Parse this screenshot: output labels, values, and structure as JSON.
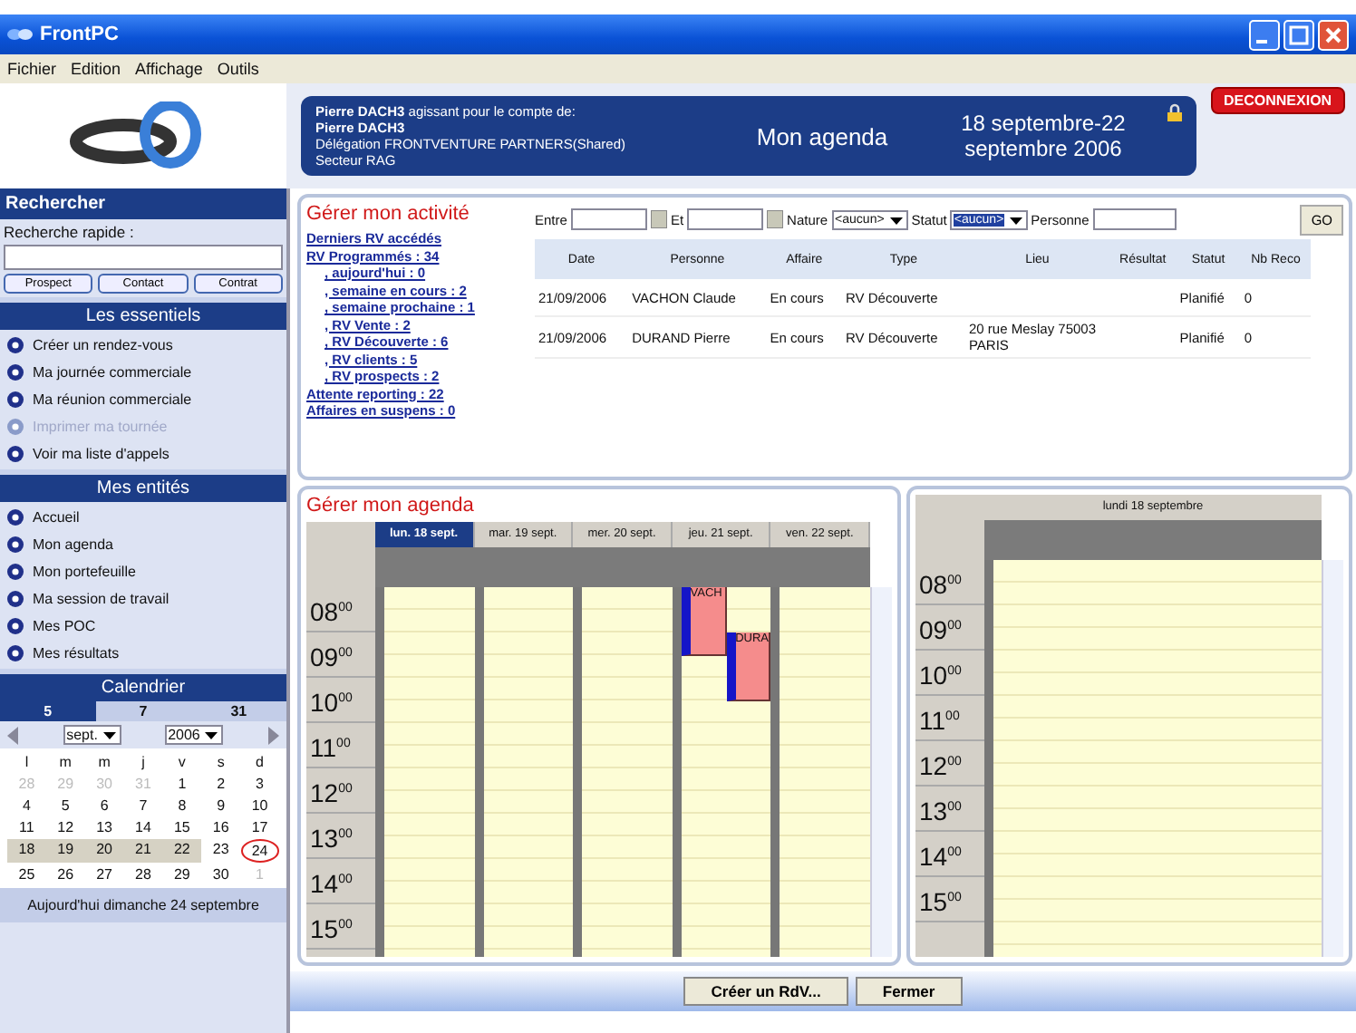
{
  "window": {
    "title": "FrontPC"
  },
  "menu": [
    "Fichier",
    "Edition",
    "Affichage",
    "Outils"
  ],
  "header": {
    "account_lines": [
      {
        "text": "**Pierre DACH3** agissant pour le compte de:",
        "bold": false
      },
      {
        "text": "Pierre DACH3",
        "bold": true
      },
      {
        "text": "Délégation FRONTVENTURE PARTNERS(Shared)",
        "bold": false
      },
      {
        "text": "Secteur RAG",
        "bold": false
      }
    ],
    "page_title": "Mon agenda",
    "date_range": "18 septembre-22 septembre 2006",
    "logout": "DECONNEXION"
  },
  "sidebar": {
    "search": {
      "title": "Rechercher",
      "label": "Recherche rapide :",
      "buttons": [
        "Prospect",
        "Contact",
        "Contrat"
      ]
    },
    "sections": [
      {
        "title": "Les essentiels",
        "items": [
          {
            "label": "Créer un rendez-vous",
            "disabled": false
          },
          {
            "label": "Ma journée commerciale",
            "disabled": false
          },
          {
            "label": "Ma réunion commerciale",
            "disabled": false
          },
          {
            "label": "Imprimer ma tournée",
            "disabled": true
          },
          {
            "label": "Voir ma liste d'appels",
            "disabled": false
          }
        ]
      },
      {
        "title": "Mes entités",
        "items": [
          {
            "label": "Accueil",
            "disabled": false
          },
          {
            "label": "Mon agenda",
            "disabled": false
          },
          {
            "label": "Mon portefeuille",
            "disabled": false
          },
          {
            "label": "Ma session de travail",
            "disabled": false
          },
          {
            "label": "Mes POC",
            "disabled": false
          },
          {
            "label": "Mes résultats",
            "disabled": false
          }
        ]
      }
    ],
    "calendar": {
      "title": "Calendrier",
      "views": [
        {
          "label": "5",
          "selected": true
        },
        {
          "label": "7",
          "selected": false
        },
        {
          "label": "31",
          "selected": false
        }
      ],
      "month": "sept.",
      "year": "2006",
      "weekdays": [
        "l",
        "m",
        "m",
        "j",
        "v",
        "s",
        "d"
      ],
      "weeks": [
        [
          {
            "t": "28",
            "muted": true,
            "selected": false,
            "today": false
          },
          {
            "t": "29",
            "muted": true,
            "selected": false,
            "today": false
          },
          {
            "t": "30",
            "muted": true,
            "selected": false,
            "today": false
          },
          {
            "t": "31",
            "muted": true,
            "selected": false,
            "today": false
          },
          {
            "t": "1",
            "muted": false,
            "selected": false,
            "today": false
          },
          {
            "t": "2",
            "muted": false,
            "selected": false,
            "today": false
          },
          {
            "t": "3",
            "muted": false,
            "selected": false,
            "today": false
          }
        ],
        [
          {
            "t": "4",
            "muted": false,
            "selected": false,
            "today": false
          },
          {
            "t": "5",
            "muted": false,
            "selected": false,
            "today": false
          },
          {
            "t": "6",
            "muted": false,
            "selected": false,
            "today": false
          },
          {
            "t": "7",
            "muted": false,
            "selected": false,
            "today": false
          },
          {
            "t": "8",
            "muted": false,
            "selected": false,
            "today": false
          },
          {
            "t": "9",
            "muted": false,
            "selected": false,
            "today": false
          },
          {
            "t": "10",
            "muted": false,
            "selected": false,
            "today": false
          }
        ],
        [
          {
            "t": "11",
            "muted": false,
            "selected": false,
            "today": false
          },
          {
            "t": "12",
            "muted": false,
            "selected": false,
            "today": false
          },
          {
            "t": "13",
            "muted": false,
            "selected": false,
            "today": false
          },
          {
            "t": "14",
            "muted": false,
            "selected": false,
            "today": false
          },
          {
            "t": "15",
            "muted": false,
            "selected": false,
            "today": false
          },
          {
            "t": "16",
            "muted": false,
            "selected": false,
            "today": false
          },
          {
            "t": "17",
            "muted": false,
            "selected": false,
            "today": false
          }
        ],
        [
          {
            "t": "18",
            "muted": false,
            "selected": true,
            "today": false
          },
          {
            "t": "19",
            "muted": false,
            "selected": true,
            "today": false
          },
          {
            "t": "20",
            "muted": false,
            "selected": true,
            "today": false
          },
          {
            "t": "21",
            "muted": false,
            "selected": true,
            "today": false
          },
          {
            "t": "22",
            "muted": false,
            "selected": true,
            "today": false
          },
          {
            "t": "23",
            "muted": false,
            "selected": false,
            "today": false
          },
          {
            "t": "24",
            "muted": false,
            "selected": false,
            "today": true
          }
        ],
        [
          {
            "t": "25",
            "muted": false,
            "selected": false,
            "today": false
          },
          {
            "t": "26",
            "muted": false,
            "selected": false,
            "today": false
          },
          {
            "t": "27",
            "muted": false,
            "selected": false,
            "today": false
          },
          {
            "t": "28",
            "muted": false,
            "selected": false,
            "today": false
          },
          {
            "t": "29",
            "muted": false,
            "selected": false,
            "today": false
          },
          {
            "t": "30",
            "muted": false,
            "selected": false,
            "today": false
          },
          {
            "t": "1",
            "muted": true,
            "selected": false,
            "today": false
          }
        ]
      ],
      "today_text": "Aujourd'hui dimanche 24 septembre"
    }
  },
  "activity": {
    "title": "Gérer mon activité",
    "filters": {
      "from_label": "Entre",
      "to_label": "Et",
      "nature_label": "Nature",
      "nature_value": "<aucun>",
      "status_label": "Statut",
      "status_value": "<aucun>",
      "person_label": "Personne",
      "go": "GO"
    },
    "links": [
      {
        "label": "Derniers RV accédés"
      },
      {
        "label": "RV Programmés : 34",
        "children": [
          {
            "label": ", aujourd'hui : 0"
          },
          {
            "label": ", semaine en cours : 2"
          },
          {
            "label": ", semaine prochaine : 1"
          },
          {
            "label": ", RV Vente : 2"
          },
          {
            "label": ", RV Découverte : 6"
          },
          {
            "label": ", RV clients : 5"
          },
          {
            "label": ", RV prospects : 2"
          }
        ]
      },
      {
        "label": "Attente reporting : 22"
      },
      {
        "label": "Affaires en suspens : 0"
      }
    ],
    "table": {
      "columns": [
        "Date",
        "Personne",
        "Affaire",
        "Type",
        "Lieu",
        "Résultat",
        "Statut",
        "Nb Reco"
      ],
      "rows": [
        [
          "21/09/2006",
          "VACHON Claude",
          "En cours",
          "RV Découverte",
          "",
          "",
          "Planifié",
          "0"
        ],
        [
          "21/09/2006",
          "DURAND Pierre",
          "En cours",
          "RV Découverte",
          "20 rue Meslay 75003 PARIS",
          "",
          "Planifié",
          "0"
        ]
      ]
    }
  },
  "agenda": {
    "title": "Gérer mon agenda",
    "week": {
      "hours": [
        "08$^{00}$",
        "09$^{00}$",
        "10$^{00}$",
        "11$^{00}$",
        "12$^{00}$",
        "13$^{00}$",
        "14$^{00}$",
        "15$^{00}$"
      ],
      "days": [
        {
          "label": "lun. 18 sept.",
          "selected": true
        },
        {
          "label": "mar. 19 sept.",
          "selected": false
        },
        {
          "label": "mer. 20 sept.",
          "selected": false
        },
        {
          "label": "jeu. 21 sept.",
          "selected": false,
          "events": [
            {
              "label": "VACH"
            },
            {
              "label": "DURA"
            }
          ]
        },
        {
          "label": "ven. 22 sept.",
          "selected": false
        }
      ]
    },
    "day": {
      "label": "lundi 18 septembre",
      "hours": [
        "08$^{00}$",
        "09$^{00}$",
        "10$^{00}$",
        "11$^{00}$",
        "12$^{00}$",
        "13$^{00}$",
        "14$^{00}$",
        "15$^{00}$"
      ]
    }
  },
  "footer": {
    "buttons": [
      "Créer un RdV...",
      "Fermer"
    ]
  }
}
